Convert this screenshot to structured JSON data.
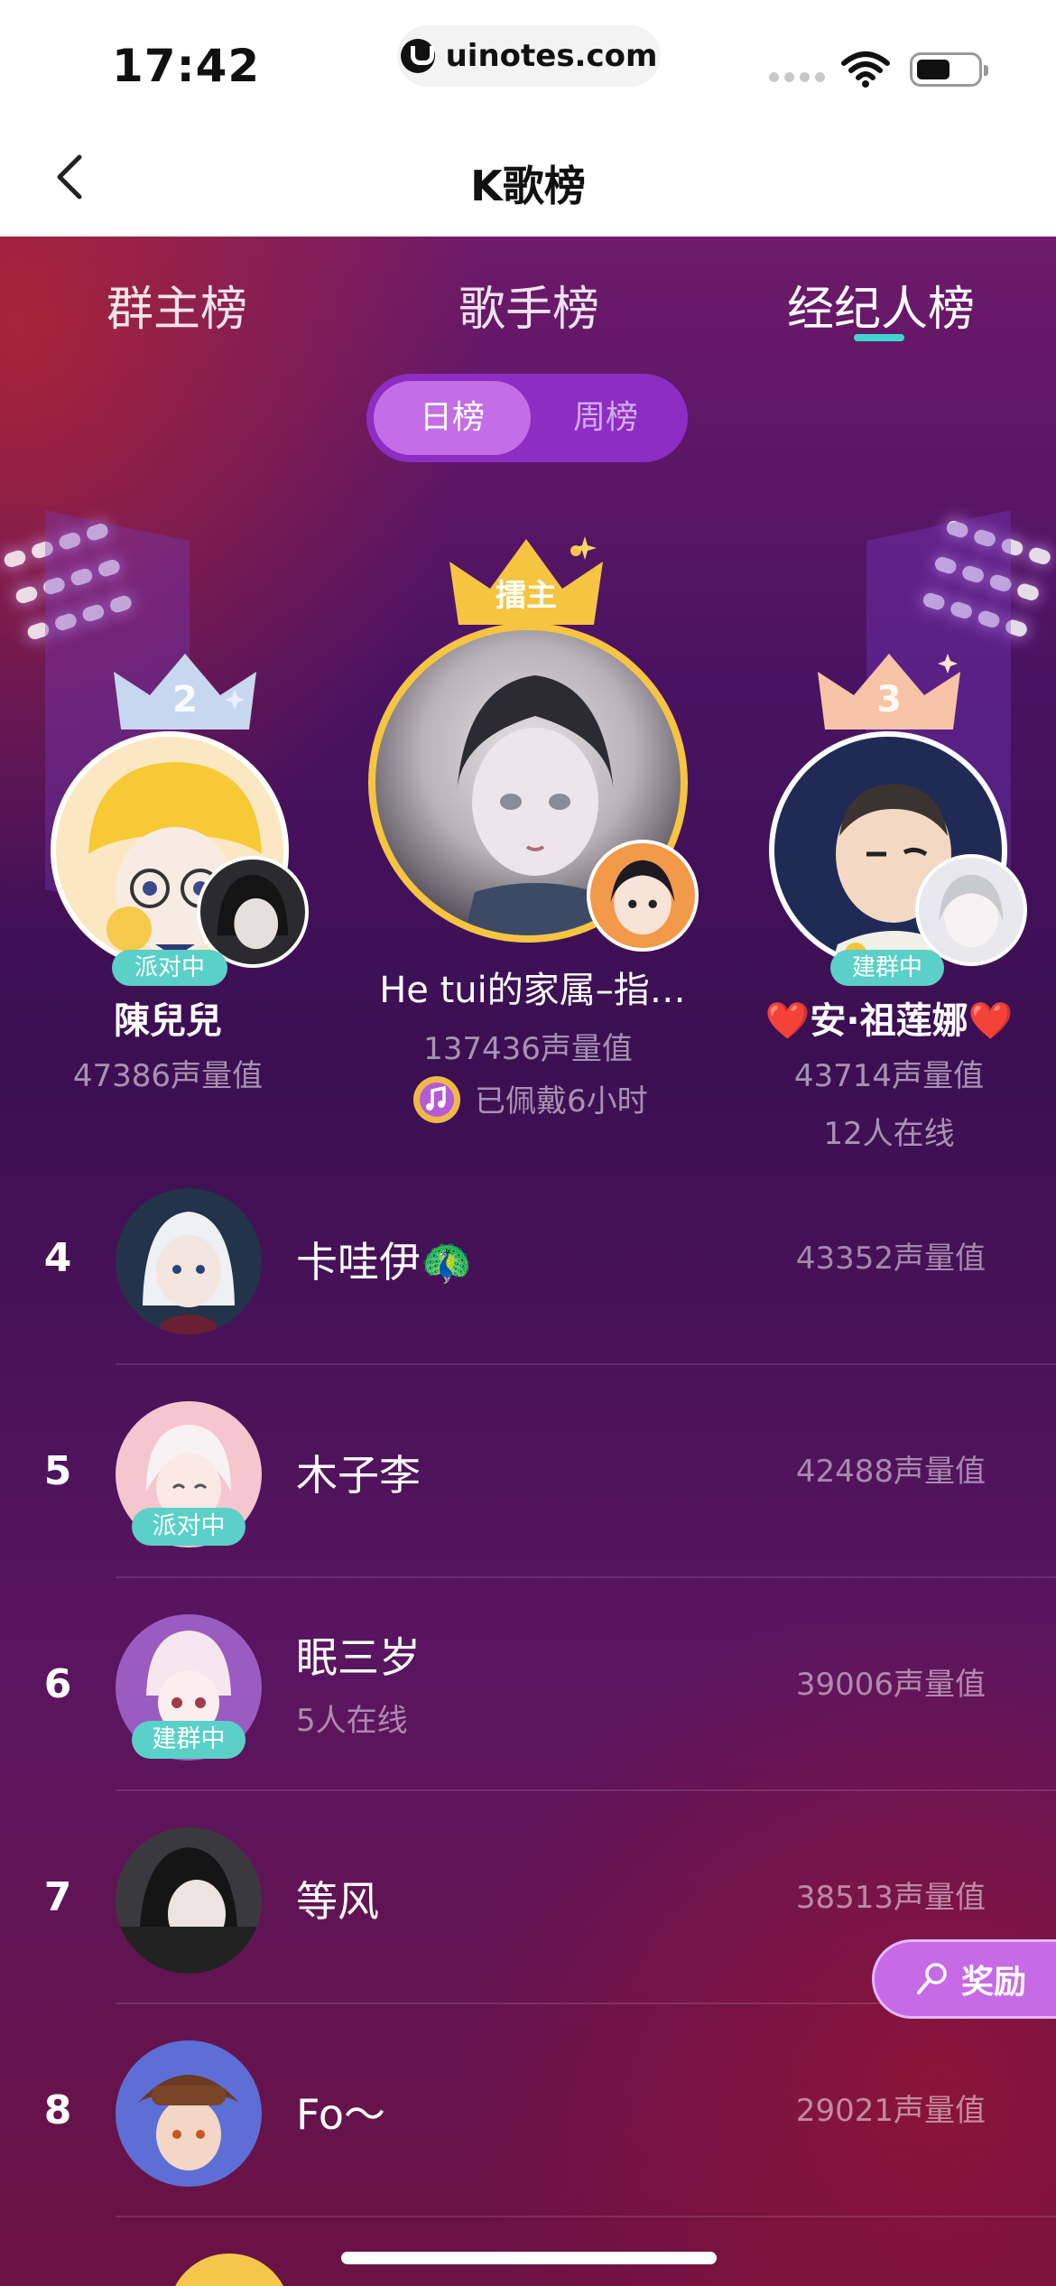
{
  "status_bar": {
    "time": "17:42",
    "url": "uinotes.com"
  },
  "nav": {
    "title": "K歌榜"
  },
  "tabs": [
    {
      "label": "群主榜",
      "active": false
    },
    {
      "label": "歌手榜",
      "active": false
    },
    {
      "label": "经纪人榜",
      "active": true
    }
  ],
  "segment": {
    "active": "日榜",
    "inactive": "周榜"
  },
  "podium": {
    "first": {
      "crown": "擂主",
      "name": "He tui的家属–指…",
      "score": "137436声量值",
      "wear_text": "已佩戴6小时"
    },
    "second": {
      "rank": "2",
      "name": "陳兒兒",
      "score": "47386声量值",
      "badge": "派对中"
    },
    "third": {
      "rank": "3",
      "name": "❤️安·祖莲娜❤️",
      "score": "43714声量值",
      "badge": "建群中",
      "online": "12人在线"
    }
  },
  "list": [
    {
      "rank": "4",
      "name": "卡哇伊🦚",
      "score": "43352声量值"
    },
    {
      "rank": "5",
      "name": "木子李",
      "score": "42488声量值",
      "badge": "派对中"
    },
    {
      "rank": "6",
      "name": "眠三岁",
      "score": "39006声量值",
      "badge": "建群中",
      "sub": "5人在线"
    },
    {
      "rank": "7",
      "name": "等风",
      "score": "38513声量值"
    },
    {
      "rank": "8",
      "name": "Fo～",
      "score": "29021声量值"
    }
  ],
  "reward_button": "奖励",
  "colors": {
    "accent_teal": "#5ad0c8",
    "segment_purple": "#8d2dc4",
    "gold": "#f5c542"
  }
}
